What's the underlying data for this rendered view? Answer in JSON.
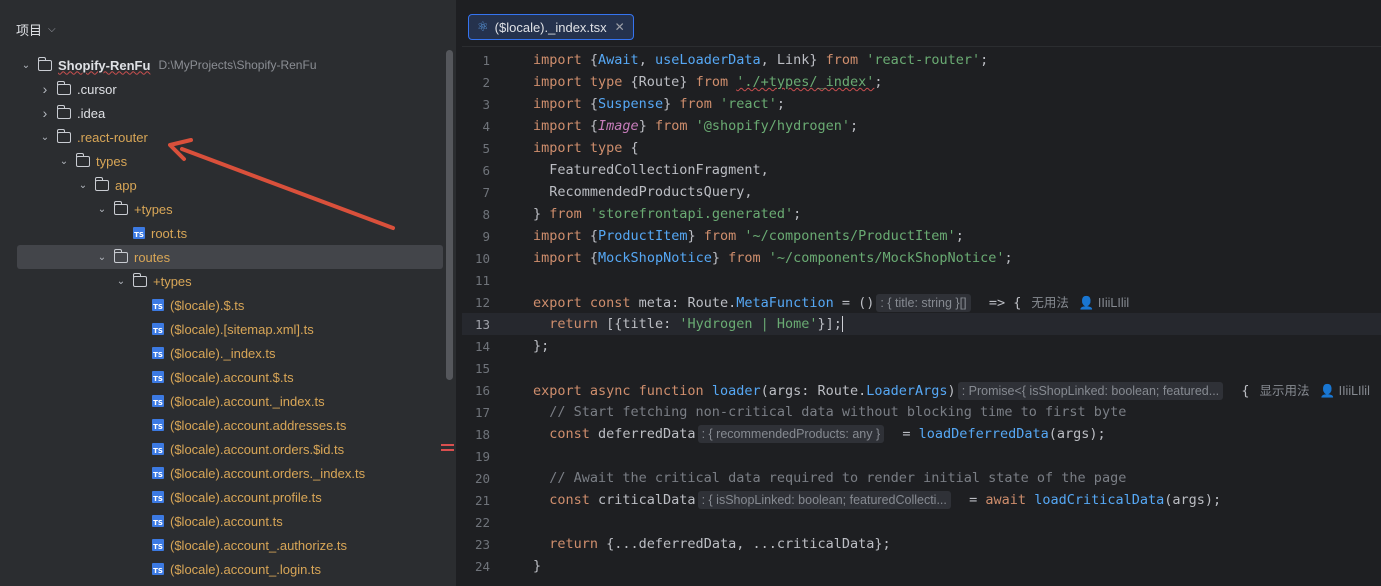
{
  "project_panel": {
    "title": "项目",
    "tree": [
      {
        "label": "Shopify-RenFu",
        "path": "D:\\MyProjects\\Shopify-RenFu",
        "type": "folder",
        "depth": 0,
        "expanded": true,
        "style": "bold"
      },
      {
        "label": ".cursor",
        "type": "folder",
        "depth": 1,
        "expanded": false,
        "style": "white"
      },
      {
        "label": ".idea",
        "type": "folder",
        "depth": 1,
        "expanded": false,
        "style": "white"
      },
      {
        "label": ".react-router",
        "type": "folder",
        "depth": 1,
        "expanded": true,
        "style": "orange"
      },
      {
        "label": "types",
        "type": "folder",
        "depth": 2,
        "expanded": true,
        "style": "orange"
      },
      {
        "label": "app",
        "type": "folder",
        "depth": 3,
        "expanded": true,
        "style": "orange"
      },
      {
        "label": "+types",
        "type": "folder",
        "depth": 4,
        "expanded": true,
        "style": "orange"
      },
      {
        "label": "root.ts",
        "type": "ts",
        "depth": 5,
        "style": "orange"
      },
      {
        "label": "routes",
        "type": "folder",
        "depth": 4,
        "expanded": true,
        "style": "orange",
        "selected": true
      },
      {
        "label": "+types",
        "type": "folder",
        "depth": 5,
        "expanded": true,
        "style": "orange"
      },
      {
        "label": "($locale).$.ts",
        "type": "ts",
        "depth": 6,
        "style": "orange"
      },
      {
        "label": "($locale).[sitemap.xml].ts",
        "type": "ts",
        "depth": 6,
        "style": "orange"
      },
      {
        "label": "($locale)._index.ts",
        "type": "ts",
        "depth": 6,
        "style": "orange"
      },
      {
        "label": "($locale).account.$.ts",
        "type": "ts",
        "depth": 6,
        "style": "orange"
      },
      {
        "label": "($locale).account._index.ts",
        "type": "ts",
        "depth": 6,
        "style": "orange"
      },
      {
        "label": "($locale).account.addresses.ts",
        "type": "ts",
        "depth": 6,
        "style": "orange"
      },
      {
        "label": "($locale).account.orders.$id.ts",
        "type": "ts",
        "depth": 6,
        "style": "orange"
      },
      {
        "label": "($locale).account.orders._index.ts",
        "type": "ts",
        "depth": 6,
        "style": "orange"
      },
      {
        "label": "($locale).account.profile.ts",
        "type": "ts",
        "depth": 6,
        "style": "orange"
      },
      {
        "label": "($locale).account.ts",
        "type": "ts",
        "depth": 6,
        "style": "orange"
      },
      {
        "label": "($locale).account_.authorize.ts",
        "type": "ts",
        "depth": 6,
        "style": "orange"
      },
      {
        "label": "($locale).account_.login.ts",
        "type": "ts",
        "depth": 6,
        "style": "orange"
      }
    ]
  },
  "editor": {
    "tab_label": "($locale)._index.tsx",
    "current_line": 13,
    "lines": [
      {
        "n": "1",
        "segs": [
          [
            "kw",
            "import "
          ],
          [
            "id",
            "{"
          ],
          [
            "type",
            "Await"
          ],
          [
            "id",
            ", "
          ],
          [
            "type",
            "useLoaderData"
          ],
          [
            "id",
            ", Link} "
          ],
          [
            "kw",
            "from "
          ],
          [
            "str",
            "'react-router'"
          ],
          [
            "id",
            ";"
          ]
        ]
      },
      {
        "n": "2",
        "segs": [
          [
            "kw",
            "import type "
          ],
          [
            "id",
            "{Route} "
          ],
          [
            "kw",
            "from "
          ],
          [
            "str squig",
            "'./+types/_index'"
          ],
          [
            "id",
            ";"
          ]
        ]
      },
      {
        "n": "3",
        "segs": [
          [
            "kw",
            "import "
          ],
          [
            "id",
            "{"
          ],
          [
            "type",
            "Suspense"
          ],
          [
            "id",
            "} "
          ],
          [
            "kw",
            "from "
          ],
          [
            "str",
            "'react'"
          ],
          [
            "id",
            ";"
          ]
        ]
      },
      {
        "n": "4",
        "segs": [
          [
            "kw",
            "import "
          ],
          [
            "id",
            "{"
          ],
          [
            "typeit",
            "Image"
          ],
          [
            "id",
            "} "
          ],
          [
            "kw",
            "from "
          ],
          [
            "str",
            "'@shopify/hydrogen'"
          ],
          [
            "id",
            ";"
          ]
        ]
      },
      {
        "n": "5",
        "segs": [
          [
            "kw",
            "import type "
          ],
          [
            "id",
            "{"
          ]
        ]
      },
      {
        "n": "6",
        "segs": [
          [
            "id",
            "  FeaturedCollectionFragment,"
          ]
        ]
      },
      {
        "n": "7",
        "segs": [
          [
            "id",
            "  RecommendedProductsQuery,"
          ]
        ]
      },
      {
        "n": "8",
        "segs": [
          [
            "id",
            "} "
          ],
          [
            "kw",
            "from "
          ],
          [
            "str",
            "'storefrontapi.generated'"
          ],
          [
            "id",
            ";"
          ]
        ]
      },
      {
        "n": "9",
        "segs": [
          [
            "kw",
            "import "
          ],
          [
            "id",
            "{"
          ],
          [
            "type",
            "ProductItem"
          ],
          [
            "id",
            "} "
          ],
          [
            "kw",
            "from "
          ],
          [
            "str",
            "'~/components/ProductItem'"
          ],
          [
            "id",
            ";"
          ]
        ]
      },
      {
        "n": "10",
        "segs": [
          [
            "kw",
            "import "
          ],
          [
            "id",
            "{"
          ],
          [
            "type",
            "MockShopNotice"
          ],
          [
            "id",
            "} "
          ],
          [
            "kw",
            "from "
          ],
          [
            "str",
            "'~/components/MockShopNotice'"
          ],
          [
            "id",
            ";"
          ]
        ]
      },
      {
        "n": "11",
        "segs": []
      },
      {
        "n": "12",
        "segs": [
          [
            "kw",
            "export const "
          ],
          [
            "id",
            "meta: Route."
          ],
          [
            "type",
            "MetaFunction"
          ],
          [
            "id",
            " = ()"
          ],
          [
            "hint",
            ": { title: string }[]"
          ],
          [
            "id",
            "  => {"
          ],
          [
            "usage",
            "无用法"
          ],
          [
            "usage",
            "👤 IIiiLIlil"
          ]
        ]
      },
      {
        "n": "13",
        "segs": [
          [
            "id",
            "  "
          ],
          [
            "kw",
            "return "
          ],
          [
            "id",
            "[{title: "
          ],
          [
            "str",
            "'Hydrogen | Home'"
          ],
          [
            "id",
            "}];"
          ],
          [
            "caret",
            ""
          ]
        ]
      },
      {
        "n": "14",
        "segs": [
          [
            "id",
            "};"
          ]
        ]
      },
      {
        "n": "15",
        "segs": []
      },
      {
        "n": "16",
        "segs": [
          [
            "kw",
            "export async function "
          ],
          [
            "fn",
            "loader"
          ],
          [
            "id",
            "(args: Route."
          ],
          [
            "type",
            "LoaderArgs"
          ],
          [
            "id",
            ")"
          ],
          [
            "hint",
            ": Promise<{ isShopLinked: boolean; featured..."
          ],
          [
            "id",
            "  {"
          ],
          [
            "usage",
            "显示用法"
          ],
          [
            "usage",
            "👤 IIiiLIlil"
          ]
        ]
      },
      {
        "n": "17",
        "segs": [
          [
            "cmt",
            "  // Start fetching non-critical data without blocking time to first byte"
          ]
        ]
      },
      {
        "n": "18",
        "segs": [
          [
            "kw",
            "  const "
          ],
          [
            "id",
            "deferredData"
          ],
          [
            "hint",
            ": { recommendedProducts: any }"
          ],
          [
            "id",
            "  = "
          ],
          [
            "fn",
            "loadDeferredData"
          ],
          [
            "id",
            "(args);"
          ]
        ]
      },
      {
        "n": "19",
        "segs": []
      },
      {
        "n": "20",
        "segs": [
          [
            "cmt",
            "  // Await the critical data required to render initial state of the page"
          ]
        ]
      },
      {
        "n": "21",
        "segs": [
          [
            "kw",
            "  const "
          ],
          [
            "id",
            "criticalData"
          ],
          [
            "hint",
            ": { isShopLinked: boolean; featuredCollecti..."
          ],
          [
            "id",
            "  = "
          ],
          [
            "kw",
            "await "
          ],
          [
            "fn",
            "loadCriticalData"
          ],
          [
            "id",
            "(args);"
          ]
        ]
      },
      {
        "n": "22",
        "segs": []
      },
      {
        "n": "23",
        "segs": [
          [
            "kw",
            "  return "
          ],
          [
            "id",
            "{...deferredData, ...criticalData};"
          ]
        ]
      },
      {
        "n": "24",
        "segs": [
          [
            "id",
            "}"
          ]
        ]
      }
    ]
  }
}
